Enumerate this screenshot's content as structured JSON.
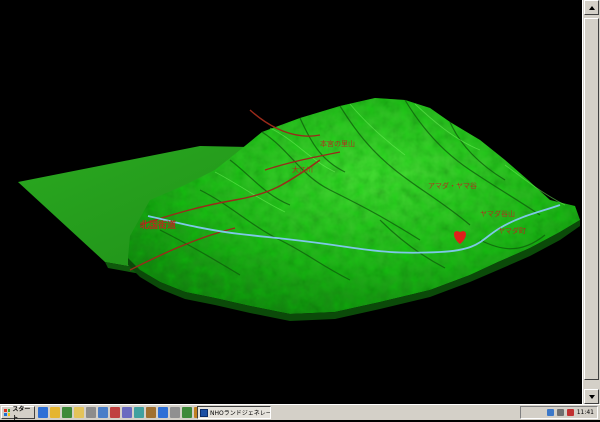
{
  "map": {
    "labels": [
      {
        "id": "kita-kaido",
        "text": "北国街道"
      },
      {
        "id": "oe-gawa",
        "text": "大江川"
      },
      {
        "id": "yagiyama",
        "text": "八木山"
      },
      {
        "id": "peak-right",
        "text": "アマダ・ヤマ谷"
      },
      {
        "id": "peak-right2",
        "text": "ヤマダ谷山"
      },
      {
        "id": "station",
        "text": "ヤマダ町"
      },
      {
        "id": "upper-ridge",
        "text": "本宮の里山"
      }
    ],
    "colors": {
      "terrain": "#27b81f",
      "terrain_dark": "#0c5a0a",
      "river": "#7ec8e8",
      "road": "#9a2a1a",
      "label": "#b0301c",
      "marker": "#e0201a"
    }
  },
  "taskbar": {
    "start_label": "スタート",
    "task_label": "NHOランドジェネレータ-[...",
    "clock": "11:41",
    "tray_icons": [
      "network-icon",
      "volume-icon",
      "ime-icon"
    ]
  },
  "quicklaunch": [
    "ie-icon",
    "outlook-icon",
    "desktop-icon",
    "folder-icon",
    "app-icon",
    "app-icon",
    "app-icon",
    "app-icon",
    "app-icon",
    "app-icon",
    "app-icon",
    "app-icon",
    "app-icon",
    "app-icon",
    "app-icon"
  ]
}
